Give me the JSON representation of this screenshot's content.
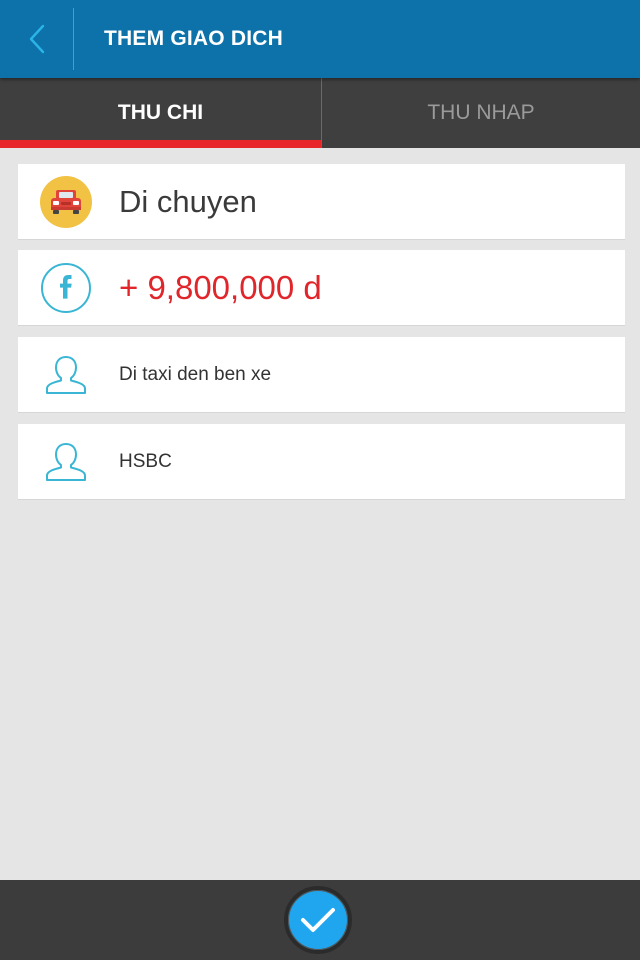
{
  "header": {
    "title": "THEM GIAO DICH",
    "back_icon": "chevron-left-icon"
  },
  "tabs": [
    {
      "label": "THU CHI",
      "active": true
    },
    {
      "label": "THU NHAP",
      "active": false
    }
  ],
  "colors": {
    "header_bg": "#0d72aa",
    "tab_bar_bg": "#3f3f3f",
    "tab_indicator": "#e8262a",
    "amount_text": "#e0262b",
    "icon_outline": "#3ab6d4",
    "confirm_button": "#1fa6ee",
    "bottom_bar_bg": "#3c3c3c"
  },
  "form": {
    "category": {
      "icon": "car-icon",
      "value": "Di chuyen"
    },
    "amount": {
      "icon": "facebook-icon",
      "value": "+ 9,800,000 d"
    },
    "note": {
      "icon": "person-icon",
      "value": "Di taxi den ben xe"
    },
    "account": {
      "icon": "person-icon",
      "value": "HSBC"
    }
  },
  "bottom_bar": {
    "confirm_icon": "checkmark-icon"
  }
}
